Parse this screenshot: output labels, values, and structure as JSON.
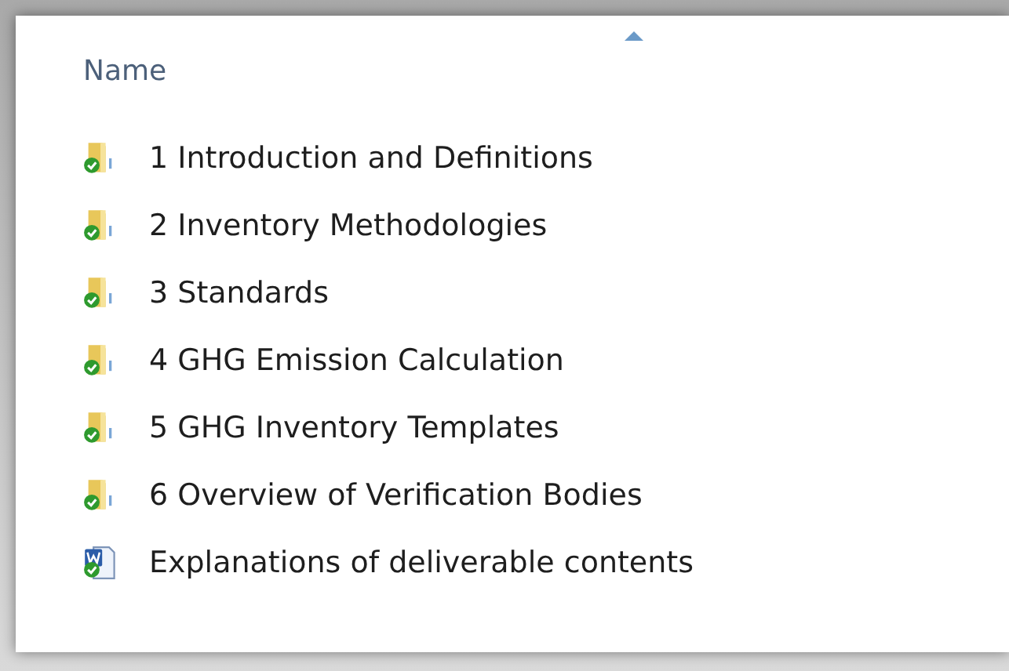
{
  "column_header": {
    "label": "Name",
    "sorted_ascending": true
  },
  "items": [
    {
      "kind": "folder",
      "name": "1 Introduction and Definitions"
    },
    {
      "kind": "folder",
      "name": "2 Inventory Methodologies"
    },
    {
      "kind": "folder",
      "name": "3 Standards"
    },
    {
      "kind": "folder",
      "name": "4 GHG Emission Calculation"
    },
    {
      "kind": "folder",
      "name": "5 GHG Inventory Templates"
    },
    {
      "kind": "folder",
      "name": "6 Overview of Verification Bodies"
    },
    {
      "kind": "document",
      "name": "Explanations of deliverable contents"
    }
  ]
}
